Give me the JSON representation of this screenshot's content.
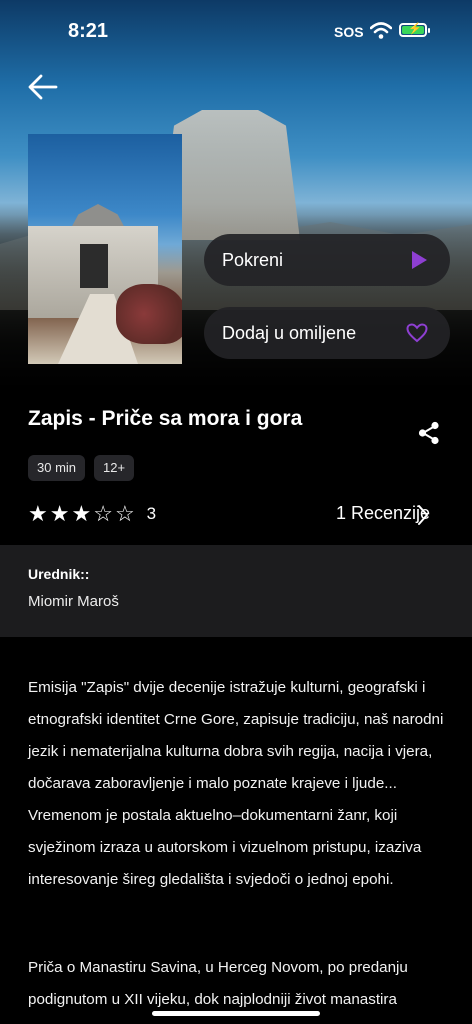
{
  "status_bar": {
    "time": "8:21",
    "sos": "SOS"
  },
  "colors": {
    "accent": "#8e3fd2",
    "battery": "#3ad65a",
    "pill_bg": "#232326",
    "chip_bg": "#26262a",
    "editor_bg": "#1c1c1e"
  },
  "header": {
    "back_icon": "arrow-left-icon"
  },
  "actions": {
    "play_label": "Pokreni",
    "play_icon": "play-icon",
    "favorite_label": "Dodaj u omiljene",
    "favorite_icon": "heart-outline-icon"
  },
  "show": {
    "title": "Zapis - Priče sa mora i gora",
    "duration": "30 min",
    "age_rating": "12+",
    "rating_stars": 3,
    "rating_max": 5,
    "rating_value": "3",
    "reviews_label": "1 Recenzije",
    "share_icon": "share-icon"
  },
  "editor": {
    "label": "Urednik::",
    "name": "Miomir Maroš"
  },
  "description": {
    "paragraph1": "Emisija \"Zapis\" dvije decenije istražuje kulturni, geografski i etnografski identitet Crne Gore, zapisuje tradiciju, naš narodni jezik i nematerijalna kulturna dobra svih regija, nacija i vjera, dočarava zaboravljenje i malo poznate krajeve i ljude... Vremenom je postala aktuelno–dokumentarni žanr, koji svježinom izraza u autorskom i vizuelnom pristupu, izaziva interesovanje šireg gledališta i svjedoči o jednoj epohi.",
    "paragraph2": "Priča o Manastiru Savina, u Herceg Novom, po predanju podignutom u XII vijeku, dok najplodniji život manastira"
  }
}
